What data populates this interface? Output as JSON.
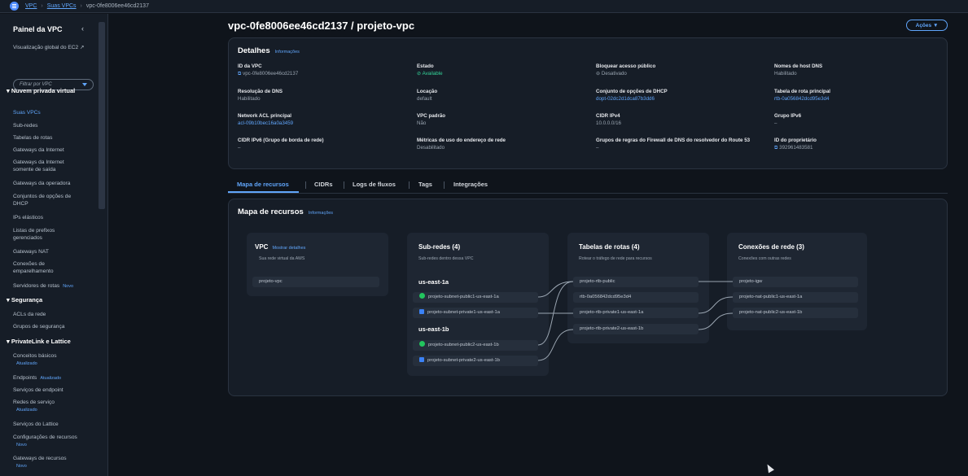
{
  "breadcrumb": [
    "VPC",
    "Suas VPCs",
    "vpc-0fe8006ee46cd2137"
  ],
  "sidebar": {
    "title": "Painel da VPC",
    "global_view": "Visualização global do EC2 ↗",
    "filter_placeholder": "Filtrar por VPC",
    "sections": {
      "vpc": "Nuvem privada virtual",
      "security": "Segurança",
      "privatelink": "PrivateLink e Lattice"
    },
    "items": {
      "vpcs": "Suas VPCs",
      "subnets": "Sub-redes",
      "route_tables": "Tabelas de rotas",
      "igw": "Gateways da Internet",
      "egress_igw": "Gateways da Internet somente de saída",
      "carrier_gw": "Gateways da operadora",
      "dhcp": "Conjuntos de opções de DHCP",
      "eips": "IPs elásticos",
      "prefix_lists": "Listas de prefixos gerenciados",
      "nat": "Gateways NAT",
      "peering": "Conexões de emparelhamento",
      "route_servers": "Servidores de rotas",
      "acls": "ACLs da rede",
      "sec_groups": "Grupos de segurança",
      "basics": "Conceitos básicos",
      "endpoints": "Endpoints",
      "endpoint_services": "Serviços de endpoint",
      "service_networks": "Redes de serviço",
      "lattice_services": "Serviços do Lattice",
      "resource_configs": "Configurações de recursos",
      "resource_gateways": "Gateways de recursos"
    },
    "badges": {
      "new": "Novo",
      "updated": "Atualizado"
    }
  },
  "page": {
    "title": "vpc-0fe8006ee46cd2137 / projeto-vpc",
    "actions": "Ações ▼",
    "info": "Informações"
  },
  "details": {
    "title": "Detalhes",
    "vpc_id_label": "ID da VPC",
    "vpc_id": "vpc-0fe8006ee46cd2137",
    "state_label": "Estado",
    "state": "Available",
    "block_label": "Bloquear acesso público",
    "block": "Desativado",
    "dns_hostnames_label": "Nomes de host DNS",
    "dns_hostnames": "Habilitado",
    "dns_res_label": "Resolução de DNS",
    "dns_res": "Habilitado",
    "tenancy_label": "Locação",
    "tenancy": "default",
    "dhcp_label": "Conjunto de opções de DHCP",
    "dhcp": "dopt-02dc2d1dca87b3dd6",
    "main_rt_label": "Tabela de rota principal",
    "main_rt": "rtb-0a056842dcd95e3d4",
    "acl_label": "Network ACL principal",
    "acl": "acl-09b10bec16a0a3459",
    "default_vpc_label": "VPC padrão",
    "default_vpc": "Não",
    "cidr_label": "CIDR IPv4",
    "cidr": "10.0.0.0/16",
    "ipv6_pool_label": "Grupo IPv6",
    "ipv6_pool": "–",
    "ipv6_cidr_label": "CIDR IPv6 (Grupo de borda de rede)",
    "ipv6_cidr": "–",
    "metrics_label": "Métricas de uso do endereço de rede",
    "metrics": "Desabilitado",
    "dns_fw_label": "Grupos de regras do Firewall de DNS do resolvedor do Route 53",
    "dns_fw": "–",
    "owner_label": "ID do proprietário",
    "owner": "392961483581"
  },
  "tabs": [
    "Mapa de recursos",
    "CIDRs",
    "Logs de fluxos",
    "Tags",
    "Integrações"
  ],
  "resource_map": {
    "title": "Mapa de recursos",
    "vpc": {
      "title": "VPC",
      "link": "Mostrar detalhes",
      "sub": "Sua rede virtual da AWS",
      "name": "projeto-vpc"
    },
    "subnets": {
      "title": "Sub-redes (4)",
      "sub": "Sub-redes dentro dessa VPC",
      "az1": "us-east-1a",
      "az2": "us-east-1b",
      "s1": "projeto-subnet-public1-us-east-1a",
      "s2": "projeto-subnet-private1-us-east-1a",
      "s3": "projeto-subnet-public2-us-east-1b",
      "s4": "projeto-subnet-private2-us-east-1b"
    },
    "route_tables": {
      "title": "Tabelas de rotas (4)",
      "sub": "Rotear o tráfego de rede para recursos",
      "r1": "projeto-rtb-public",
      "r2": "rtb-0a056842dcd95e3d4",
      "r3": "projeto-rtb-private1-us-east-1a",
      "r4": "projeto-rtb-private2-us-east-1b"
    },
    "connections": {
      "title": "Conexões de rede (3)",
      "sub": "Conexões com outras redes",
      "c1": "projeto-igw",
      "c2": "projeto-nat-public1-us-east-1a",
      "c3": "projeto-nat-public2-us-east-1b"
    }
  }
}
